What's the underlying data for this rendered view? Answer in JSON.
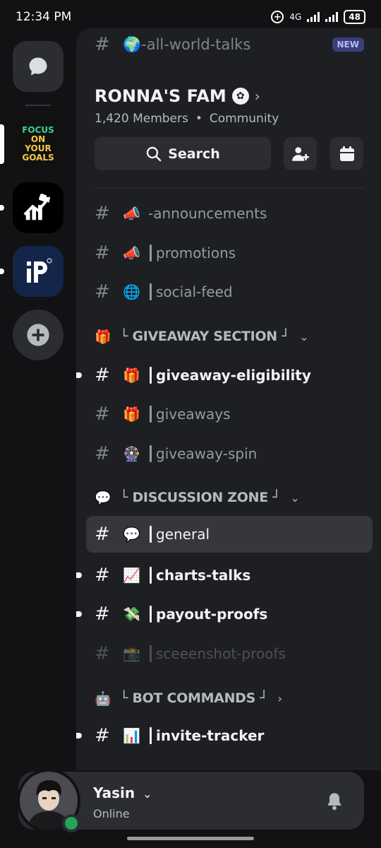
{
  "status_bar": {
    "time": "12:34 PM",
    "network": "4G",
    "battery": "48"
  },
  "server": {
    "name": "RONNA'S FAM",
    "members": "1,420 Members",
    "type": "Community",
    "search_label": "Search",
    "new_badge": "NEW",
    "top_channel": {
      "emoji": "🌍",
      "name": "-all-world-talks"
    }
  },
  "rail": {
    "focus_lines": [
      "FOCUS",
      "ON",
      "YOUR",
      "GOALS"
    ]
  },
  "channels": [
    {
      "emoji": "📣",
      "name": "-announcements",
      "sep": false
    },
    {
      "emoji": "📣",
      "name": "promotions",
      "sep": true
    },
    {
      "emoji": "🌐",
      "name": "social-feed",
      "sep": true
    }
  ],
  "categories": [
    {
      "emoji": "🎁",
      "name": "└ GIVEAWAY SECTION ┘",
      "chevron": "⌄"
    },
    {
      "emoji": "💬",
      "name": "└ DISCUSSION ZONE ┘",
      "chevron": "⌄"
    },
    {
      "emoji": "🤖",
      "name": "└ BOT COMMANDS ┘",
      "chevron": "›"
    }
  ],
  "giveaway_channels": [
    {
      "emoji": "🎁",
      "name": "giveaway-eligibility"
    },
    {
      "emoji": "🎁",
      "name": "giveaways"
    },
    {
      "emoji": "🎡",
      "name": "giveaway-spin"
    }
  ],
  "discussion_channels": [
    {
      "emoji": "💬",
      "name": "general"
    },
    {
      "emoji": "📈",
      "name": "charts-talks"
    },
    {
      "emoji": "💸",
      "name": "payout-proofs"
    },
    {
      "emoji": "📸",
      "name": "sceeenshot-proofs"
    }
  ],
  "bot_channels": [
    {
      "emoji": "📊",
      "name": "invite-tracker"
    }
  ],
  "hash": "#",
  "bullet": "•",
  "user": {
    "name": "Yasin",
    "status": "Online",
    "chevron": "⌄"
  }
}
